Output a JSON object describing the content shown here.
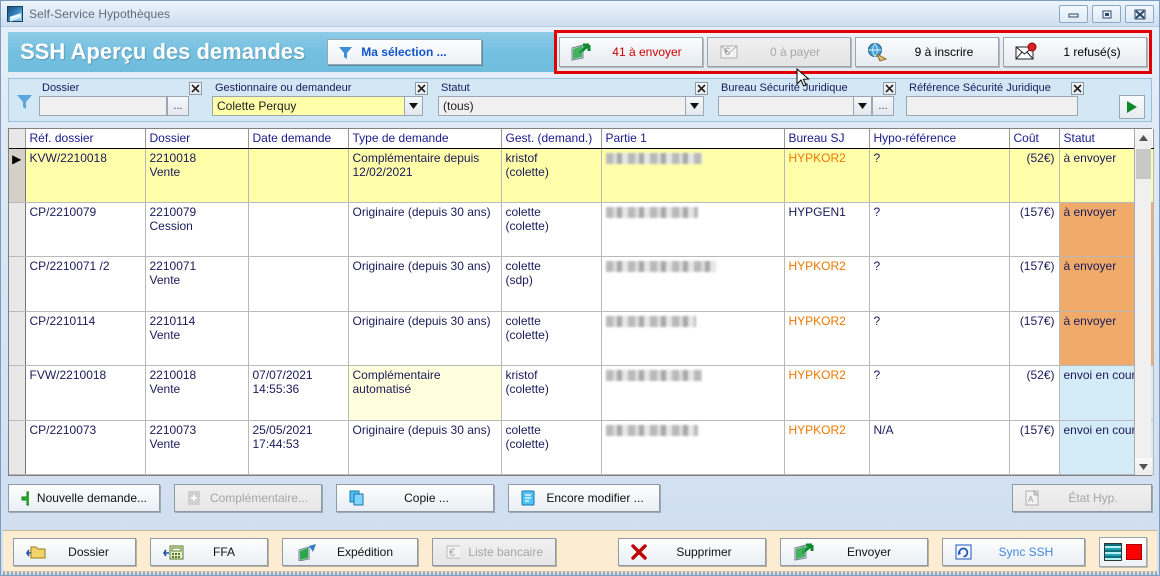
{
  "window": {
    "title": "Self-Service Hypothèques",
    "app_icon": "app-icon",
    "controls": {
      "minimize": "minimize-icon",
      "maximize": "maximize-icon",
      "close": "close-icon"
    }
  },
  "header": {
    "title": "SSH  Aperçu des demandes",
    "selection_button": {
      "label": "Ma sélection ...",
      "icon": "funnel-icon"
    },
    "counters": [
      {
        "label": "41 à envoyer",
        "icon": "send-green-icon",
        "state": "active",
        "color": "#cc0000"
      },
      {
        "label": "0 à payer",
        "icon": "euro-envelope-icon",
        "state": "disabled",
        "color": "#a8a8a8"
      },
      {
        "label": "9 à inscrire",
        "icon": "globe-hand-icon",
        "state": "active",
        "color": "#000000"
      },
      {
        "label": "1 refusé(s)",
        "icon": "mail-reject-icon",
        "state": "active",
        "color": "#000000"
      }
    ]
  },
  "filters": {
    "funnel_icon": "funnel-icon",
    "fields": [
      {
        "label": "Dossier",
        "value": "",
        "type": "text-browse",
        "clear_icon": "clear-icon",
        "browse_label": "..."
      },
      {
        "label": "Gestionnaire ou demandeur",
        "value": "Colette Perquy",
        "type": "combo",
        "clear_icon": "clear-icon"
      },
      {
        "label": "Statut",
        "value": "(tous)",
        "type": "combo",
        "clear_icon": "clear-icon"
      },
      {
        "label": "Bureau Sécurité Juridique",
        "value": "",
        "type": "combo-browse",
        "clear_icon": "clear-icon",
        "browse_label": "..."
      },
      {
        "label": "Référence Sécurité Juridique",
        "value": "",
        "type": "text",
        "clear_icon": "clear-icon"
      }
    ],
    "run_button": {
      "icon": "play-green-icon"
    }
  },
  "grid": {
    "columns": [
      "Réf. dossier",
      "Dossier",
      "Date demande",
      "Type de demande",
      "Gest. (demand.)",
      "Partie 1",
      "Bureau SJ",
      "Hypo-référence",
      "Coût",
      "Statut"
    ],
    "rows": [
      {
        "marker": "▶",
        "selected": true,
        "ref": "KVW/2210018",
        "dossier": "2210018",
        "dossier_sub": "Vente",
        "date": "",
        "date_sub": "",
        "type": "Complémentaire depuis",
        "type_sub": "12/02/2021",
        "type_highlight": false,
        "gest": "kristof",
        "gest_sub": "(colette)",
        "partie1": "",
        "partie1_width": 96,
        "bureau": "HYPKOR2",
        "bureau_orange": true,
        "hypo": "?",
        "cout": "(52€)",
        "statut": "à envoyer",
        "statut_state": "send"
      },
      {
        "marker": "",
        "selected": false,
        "ref": "CP/2210079",
        "dossier": "2210079",
        "dossier_sub": "Cession",
        "date": "",
        "date_sub": "",
        "type": "Originaire (depuis 30 ans)",
        "type_sub": "",
        "type_highlight": false,
        "gest": "colette",
        "gest_sub": "(colette)",
        "partie1": "",
        "partie1_width": 92,
        "bureau": "HYPGEN1",
        "bureau_orange": false,
        "hypo": "?",
        "cout": "(157€)",
        "statut": "à envoyer",
        "statut_state": "send"
      },
      {
        "marker": "",
        "selected": false,
        "ref": "CP/2210071 /2",
        "dossier": "2210071",
        "dossier_sub": "Vente",
        "date": "",
        "date_sub": "",
        "type": "Originaire (depuis 30 ans)",
        "type_sub": "",
        "type_highlight": false,
        "gest": "colette",
        "gest_sub": "(sdp)",
        "partie1": "",
        "partie1_width": 110,
        "bureau": "HYPKOR2",
        "bureau_orange": true,
        "hypo": "?",
        "cout": "(157€)",
        "statut": "à envoyer",
        "statut_state": "send"
      },
      {
        "marker": "",
        "selected": false,
        "ref": "CP/2210114",
        "dossier": "2210114",
        "dossier_sub": "Vente",
        "date": "",
        "date_sub": "",
        "type": "Originaire (depuis 30 ans)",
        "type_sub": "",
        "type_highlight": false,
        "gest": "colette",
        "gest_sub": "(colette)",
        "partie1": "",
        "partie1_width": 90,
        "bureau": "HYPKOR2",
        "bureau_orange": true,
        "hypo": "?",
        "cout": "(157€)",
        "statut": "à envoyer",
        "statut_state": "send"
      },
      {
        "marker": "",
        "selected": false,
        "ref": "FVW/2210018",
        "dossier": "2210018",
        "dossier_sub": "Vente",
        "date": "07/07/2021",
        "date_sub": "14:55:36",
        "type": "Complémentaire",
        "type_sub": "automatisé",
        "type_highlight": true,
        "gest": "kristof",
        "gest_sub": "(colette)",
        "partie1": "",
        "partie1_width": 96,
        "bureau": "HYPKOR2",
        "bureau_orange": true,
        "hypo": "?",
        "cout": "(52€)",
        "statut": "envoi en cours",
        "statut_state": "prog"
      },
      {
        "marker": "",
        "selected": false,
        "ref": "CP/2210073",
        "dossier": "2210073",
        "dossier_sub": "Vente",
        "date": "25/05/2021",
        "date_sub": "17:44:53",
        "type": "Originaire (depuis 30 ans)",
        "type_sub": "",
        "type_highlight": false,
        "gest": "colette",
        "gest_sub": "(colette)",
        "partie1": "",
        "partie1_width": 92,
        "bureau": "HYPKOR2",
        "bureau_orange": true,
        "hypo": "N/A",
        "cout": "(157€)",
        "statut": "envoi en cours",
        "statut_state": "prog"
      }
    ]
  },
  "action_row": [
    {
      "label": "Nouvelle demande...",
      "icon": "plus-green-icon",
      "state": "active"
    },
    {
      "label": "Complémentaire...",
      "icon": "document-add-icon",
      "state": "disabled"
    },
    {
      "label": "Copie ...",
      "icon": "copy-icon",
      "state": "active"
    },
    {
      "label": "Encore modifier ...",
      "icon": "document-edit-icon",
      "state": "active"
    },
    {
      "label": "État Hyp.",
      "icon": "pdf-icon",
      "state": "disabled"
    }
  ],
  "bottom_bar": {
    "left_buttons": [
      {
        "label": "Dossier",
        "icon": "folder-icon",
        "state": "active"
      },
      {
        "label": "FFA",
        "icon": "calculator-icon",
        "state": "active"
      },
      {
        "label": "Expédition",
        "icon": "shipping-icon",
        "state": "active"
      },
      {
        "label": "Liste bancaire",
        "icon": "euro-list-icon",
        "state": "disabled"
      }
    ],
    "right_buttons": [
      {
        "label": "Supprimer",
        "icon": "delete-x-icon",
        "state": "active"
      },
      {
        "label": "Envoyer",
        "icon": "send-green-icon",
        "state": "active"
      },
      {
        "label": "Sync SSH",
        "icon": "refresh-icon",
        "state": "active",
        "color": "#4488dd"
      }
    ],
    "indicator": {
      "stripes": "stripes-icon",
      "status": "red-square-icon",
      "color": "#ff0000"
    }
  },
  "colors": {
    "header_blue": "#73c0e0",
    "accent_red": "#e00000",
    "status_send_bg": "#f0ab6b",
    "status_progress_bg": "#d4ebf8",
    "selected_row": "#ffffaa",
    "bottom_bar": "#fbecd2"
  }
}
